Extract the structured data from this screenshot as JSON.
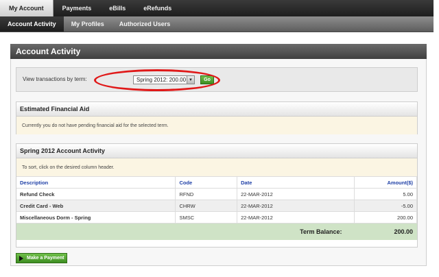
{
  "top_nav": [
    "My Account",
    "Payments",
    "eBills",
    "eRefunds"
  ],
  "sub_nav": [
    "Account Activity",
    "My Profiles",
    "Authorized Users"
  ],
  "page_title": "Account Activity",
  "term_selector": {
    "label": "View transactions by term:",
    "selected": "Spring 2012: 200.00",
    "go_label": "Go"
  },
  "financial_aid": {
    "title": "Estimated Financial Aid",
    "message": "Currently you do not have pending financial aid for the selected term."
  },
  "activity": {
    "title": "Spring 2012 Account Activity",
    "sort_hint": "To sort, click on the desired column header.",
    "columns": [
      "Description",
      "Code",
      "Date",
      "Amount($)"
    ],
    "rows": [
      {
        "description": "Refund Check",
        "code": "RFND",
        "date": "22-MAR-2012",
        "amount": "5.00"
      },
      {
        "description": "Credit Card - Web",
        "code": "CHRW",
        "date": "22-MAR-2012",
        "amount": "-5.00"
      },
      {
        "description": "Miscellaneous Dorm - Spring",
        "code": "SMSC",
        "date": "22-MAR-2012",
        "amount": "200.00"
      }
    ],
    "balance_label": "Term Balance:",
    "balance_value": "200.00"
  },
  "make_payment_label": "Make a Payment",
  "colors": {
    "highlight_circle": "#e01818",
    "go_button": "#4a9e2c",
    "balance_row": "#cfe3c6",
    "column_header_text": "#1e3fa6"
  }
}
